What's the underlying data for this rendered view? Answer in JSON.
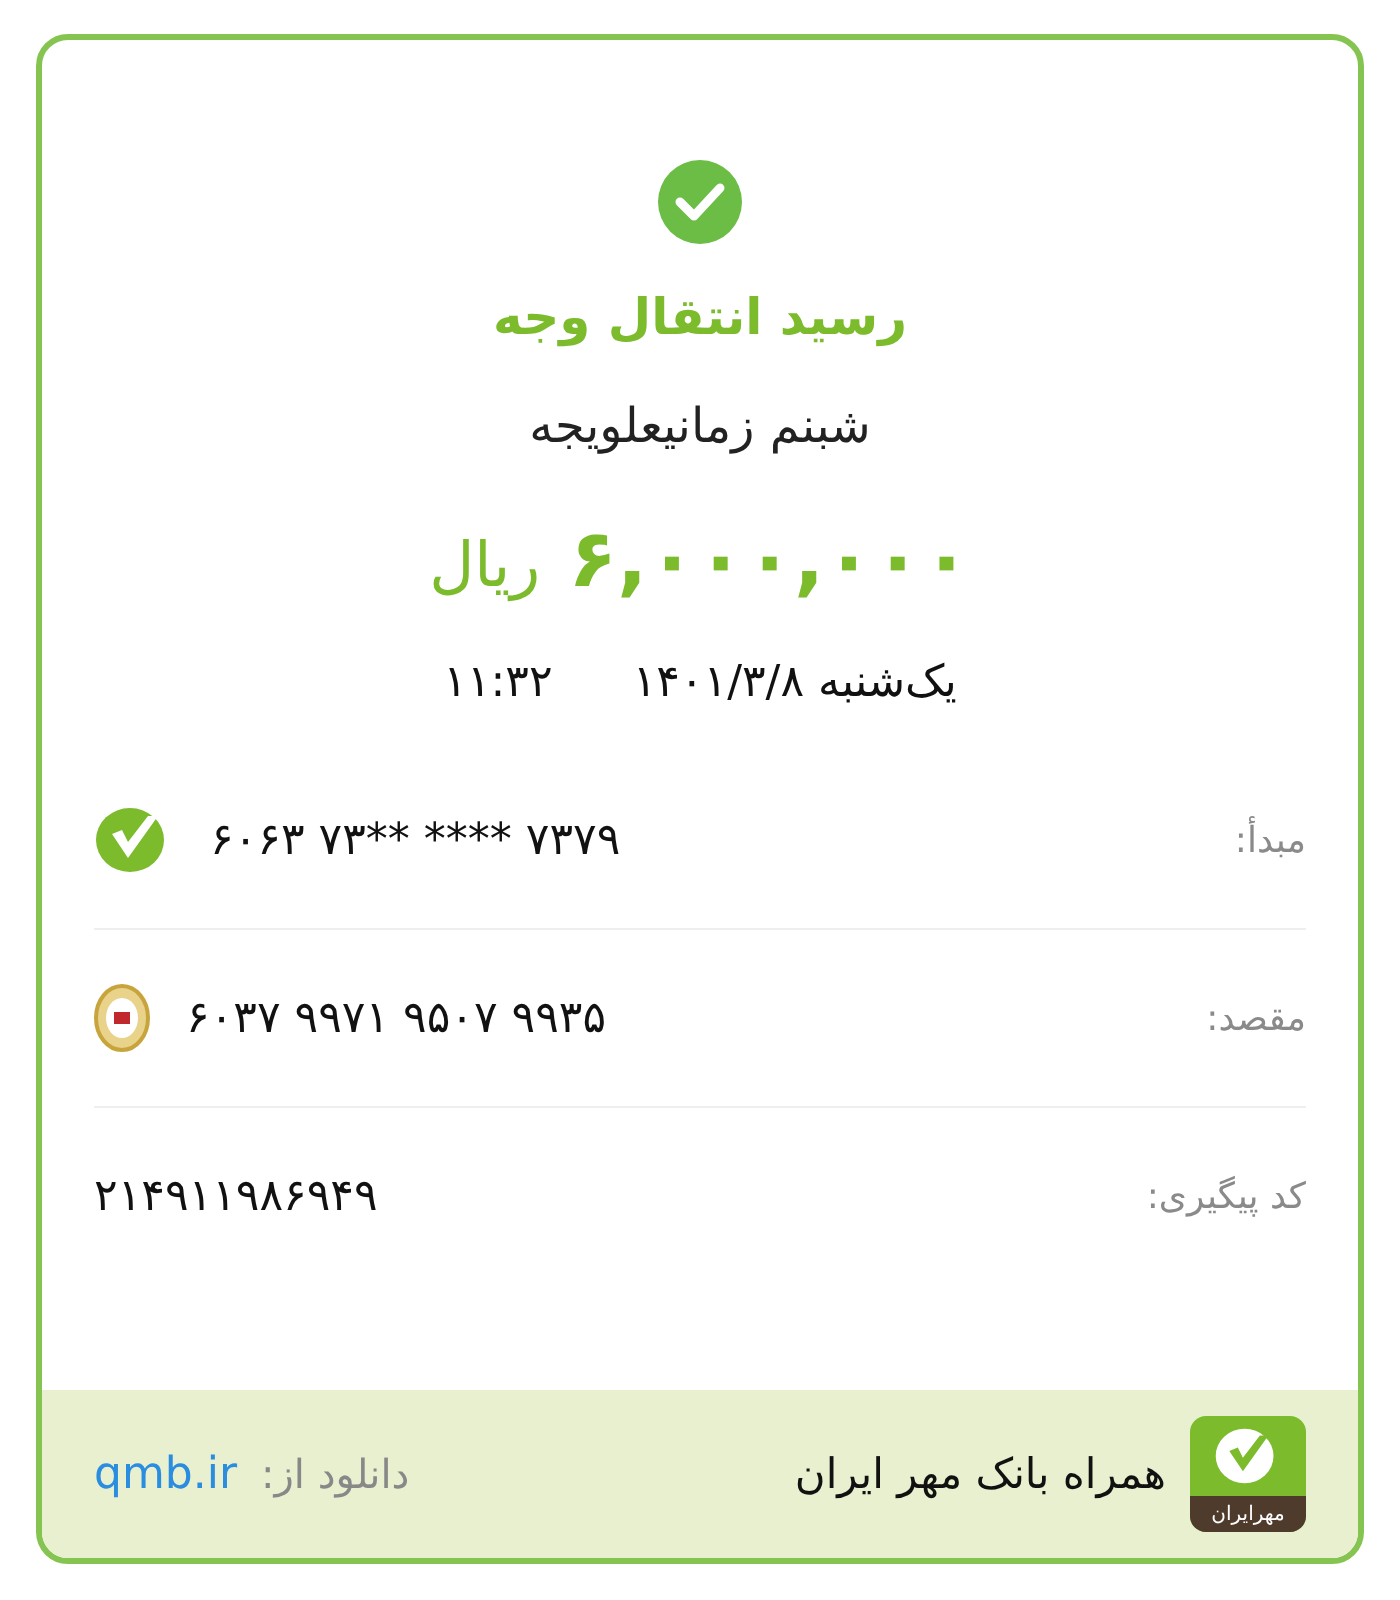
{
  "receipt": {
    "title": "رسید انتقال وجه",
    "recipient": "شبنم زمانیعلویجه",
    "amount": "۶,۰۰۰,۰۰۰",
    "currency": "ریال",
    "date": "یک‌شنبه ۱۴۰۱/۳/۸",
    "time": "۱۱:۳۲"
  },
  "details": [
    {
      "label": "مبدأ:",
      "value": "۶۰۶۳ ۷۳** **** ۷۳۷۹",
      "kind": "mehr"
    },
    {
      "label": "مقصد:",
      "value": "۶۰۳۷ ۹۹۷۱ ۹۵۰۷ ۹۹۳۵",
      "kind": "melli"
    },
    {
      "label": "کد پیگیری:",
      "value": "۲۱۴۹۱۱۹۸۶۹۴۹",
      "kind": "plain"
    }
  ],
  "footer": {
    "app_name": "همراه بانک مهر ایران",
    "logo_text": "مهرایران",
    "download_label": "دانلود از:",
    "link": "qmb.ir"
  }
}
